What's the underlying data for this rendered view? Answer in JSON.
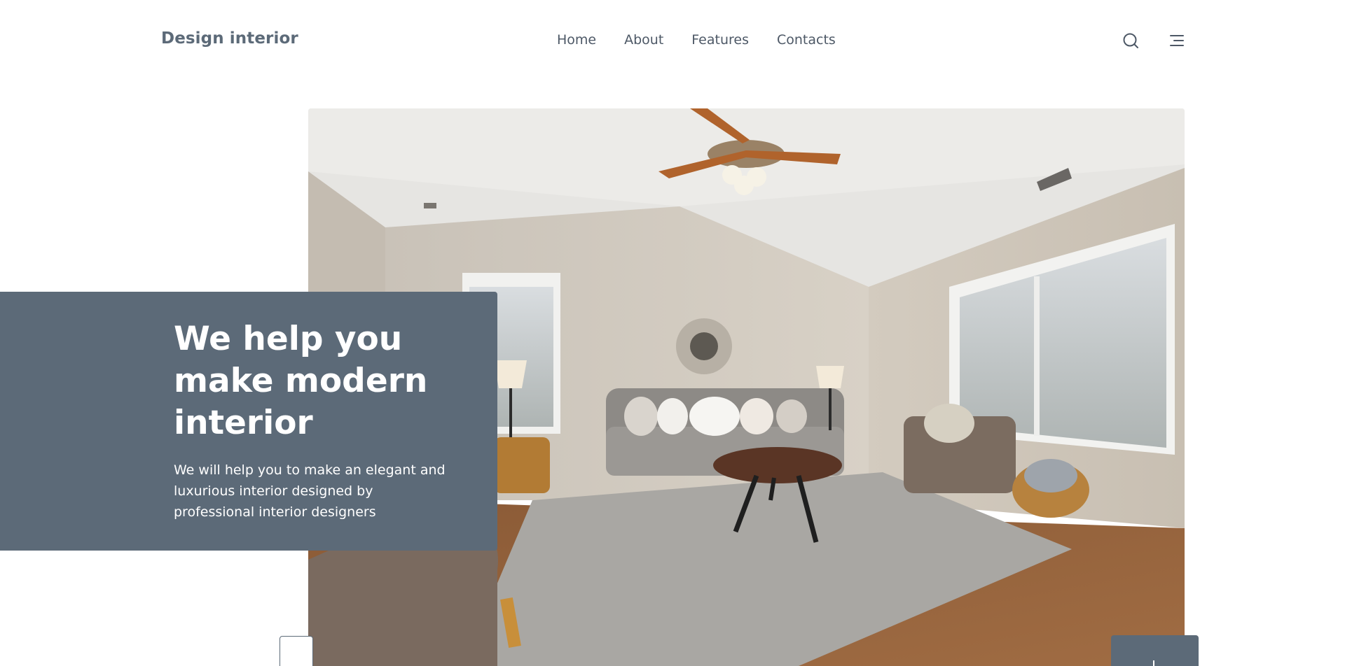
{
  "header": {
    "logo": "Design interior",
    "nav": [
      "Home",
      "About",
      "Features",
      "Contacts"
    ],
    "search_icon": "search-icon",
    "menu_icon": "menu-icon"
  },
  "hero": {
    "title": "We help you make modern interior",
    "description": "We will help you to make an elegant and luxurious interior designed by professional interior designers",
    "image": "living-room-photo",
    "accent_color": "#5c6a78"
  },
  "slider": {
    "prev_icon": "arrow-left-icon",
    "next_icon": "arrow-right-icon"
  }
}
